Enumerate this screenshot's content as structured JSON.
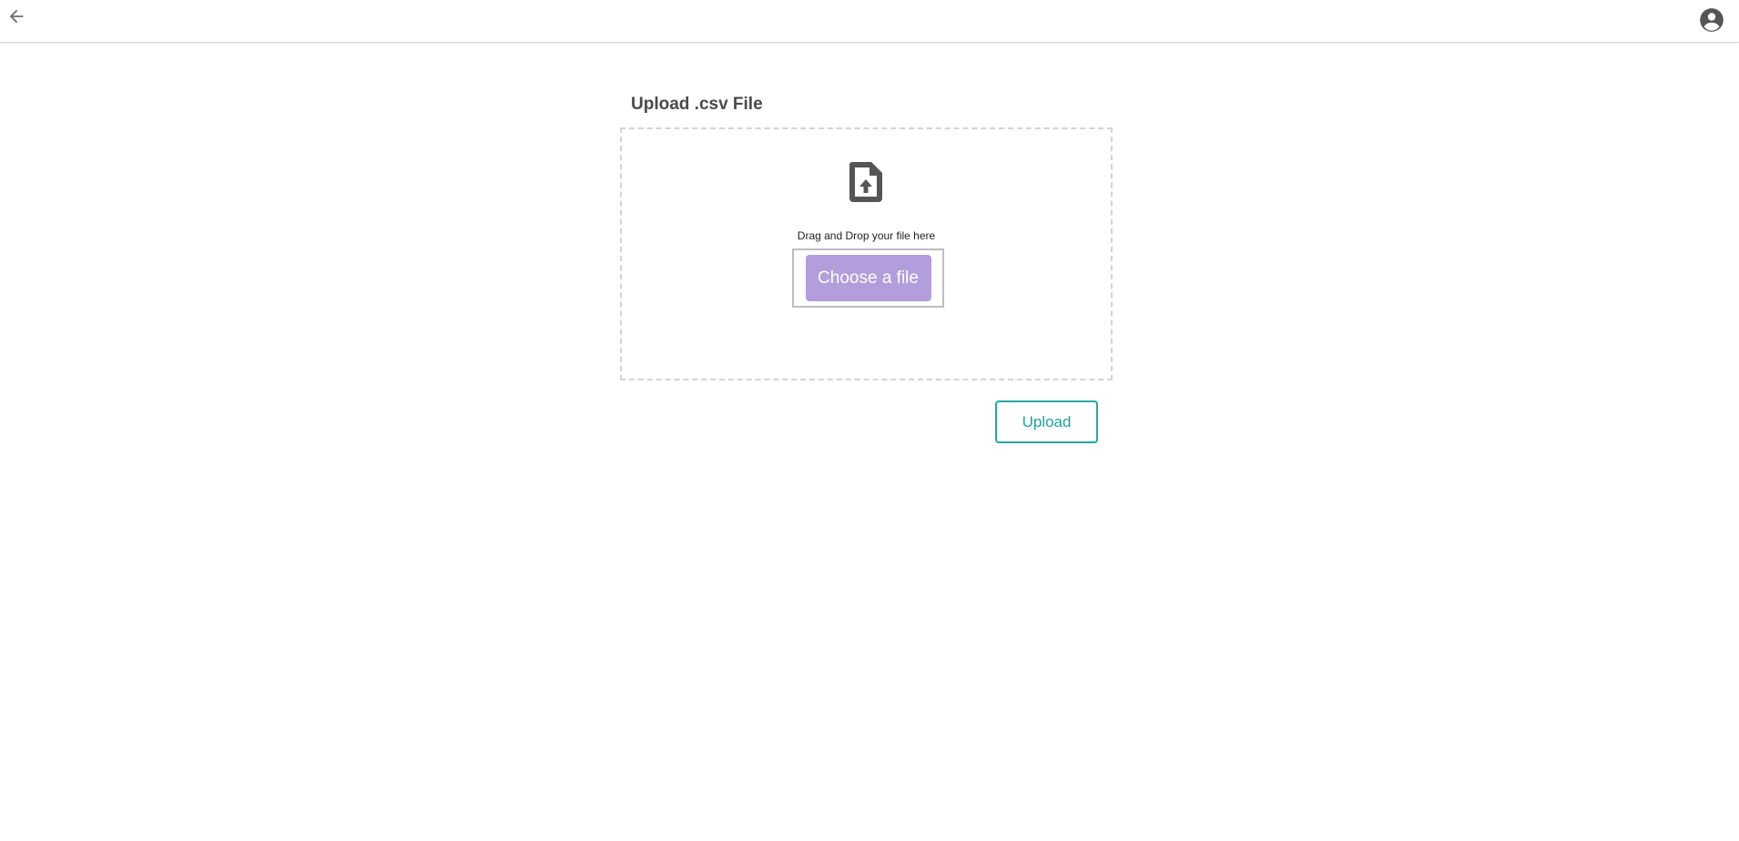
{
  "header": {
    "back_icon": "arrow-left-icon",
    "account_icon": "account-circle-icon"
  },
  "upload": {
    "title": "Upload .csv File",
    "file_icon": "file-upload-icon",
    "drop_text": "Drag and Drop your file here",
    "choose_label": "Choose a file",
    "upload_label": "Upload"
  },
  "colors": {
    "choose_button": "#b39ddb",
    "upload_accent": "#26a6a6",
    "icon_gray": "#555555",
    "title_text": "#4a4a4a",
    "dropzone_border": "#d4d4d4"
  }
}
